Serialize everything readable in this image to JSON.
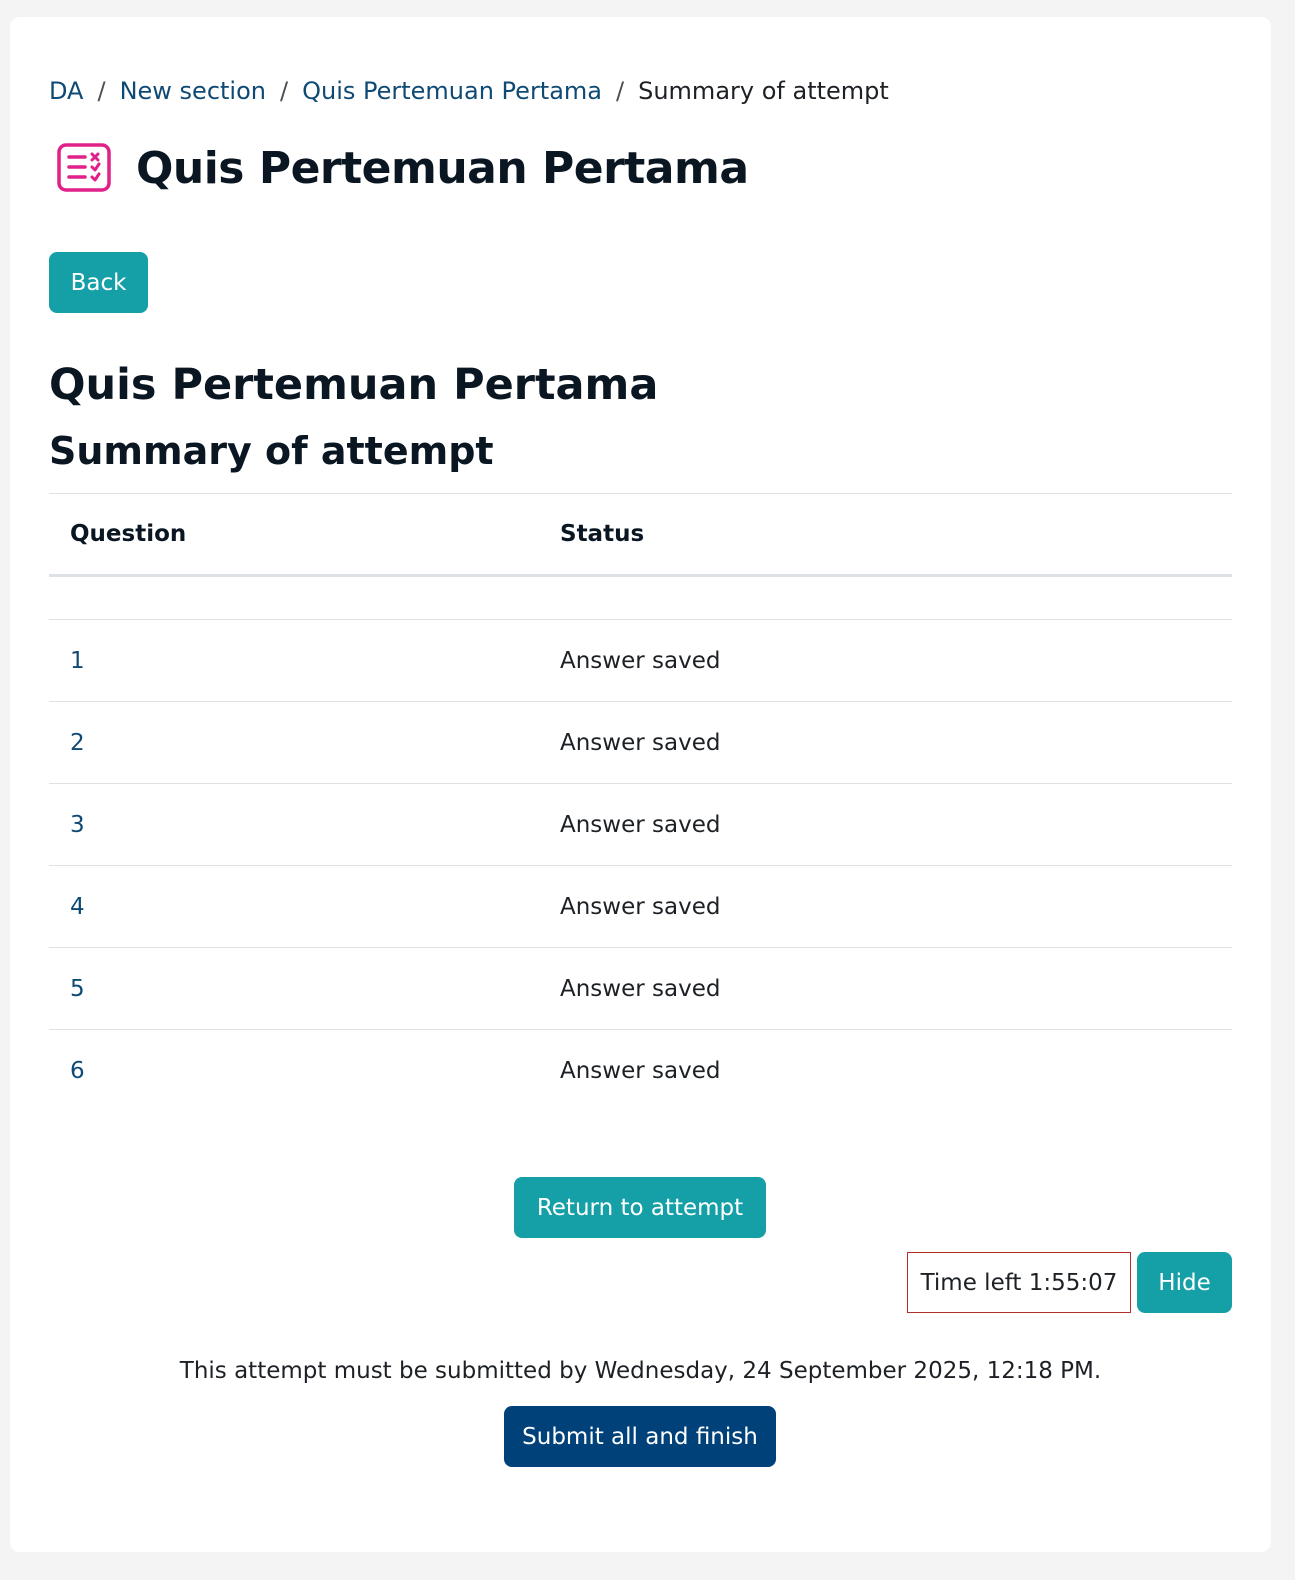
{
  "breadcrumb": {
    "items": [
      {
        "label": "DA"
      },
      {
        "label": "New section"
      },
      {
        "label": "Quis Pertemuan Pertama"
      }
    ],
    "current": "Summary of attempt",
    "separator": "/"
  },
  "header": {
    "icon": "quiz-icon",
    "title": "Quis Pertemuan Pertama"
  },
  "back_button": "Back",
  "quiz_name": "Quis Pertemuan Pertama",
  "summary_heading": "Summary of attempt",
  "table": {
    "columns": [
      "Question",
      "Status"
    ],
    "rows": [
      {
        "question": "1",
        "status": "Answer saved"
      },
      {
        "question": "2",
        "status": "Answer saved"
      },
      {
        "question": "3",
        "status": "Answer saved"
      },
      {
        "question": "4",
        "status": "Answer saved"
      },
      {
        "question": "5",
        "status": "Answer saved"
      },
      {
        "question": "6",
        "status": "Answer saved"
      }
    ]
  },
  "return_button": "Return to attempt",
  "timer": {
    "text": "Time left 1:55:07"
  },
  "hide_button": "Hide",
  "deadline_text": "This attempt must be submitted by Wednesday, 24 September 2025, 12:18 PM.",
  "submit_button": "Submit all and finish",
  "colors": {
    "accent_teal": "#15a0a8",
    "primary_navy": "#004179",
    "link": "#0f4a74",
    "quiz_icon": "#e0218a",
    "timer_border": "#b32d2d"
  }
}
